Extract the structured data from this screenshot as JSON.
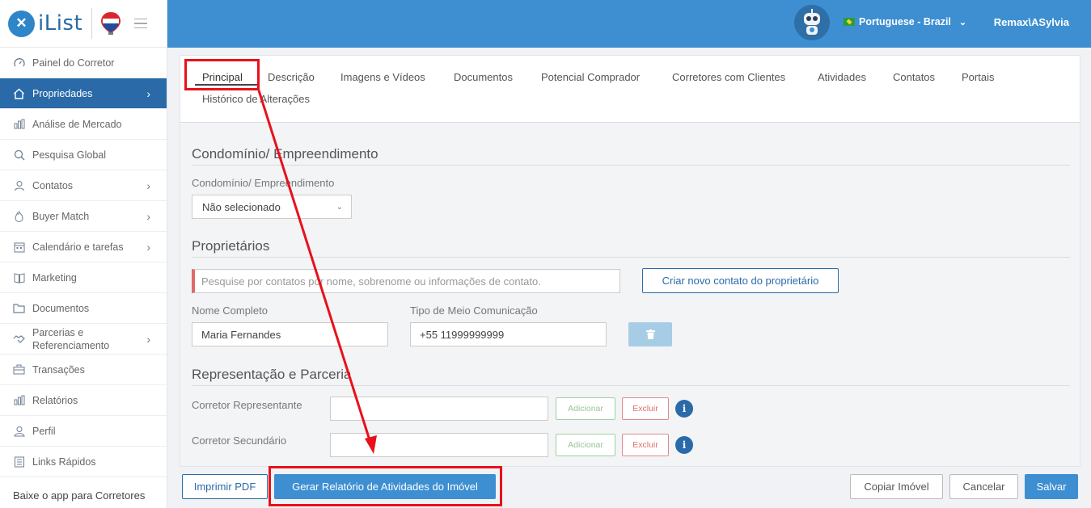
{
  "app": {
    "name": "iList"
  },
  "sidebar": {
    "items": [
      {
        "label": "Painel do Corretor",
        "icon": "dashboard-icon",
        "chevron": false
      },
      {
        "label": "Propriedades",
        "icon": "home-icon",
        "chevron": true,
        "active": true
      },
      {
        "label": "Análise de Mercado",
        "icon": "bar-chart-icon",
        "chevron": false
      },
      {
        "label": "Pesquisa Global",
        "icon": "search-icon",
        "chevron": false
      },
      {
        "label": "Contatos",
        "icon": "contacts-icon",
        "chevron": true
      },
      {
        "label": "Buyer Match",
        "icon": "flame-icon",
        "chevron": true
      },
      {
        "label": "Calendário e tarefas",
        "icon": "calendar-icon",
        "chevron": true
      },
      {
        "label": "Marketing",
        "icon": "book-icon",
        "chevron": false
      },
      {
        "label": "Documentos",
        "icon": "folder-icon",
        "chevron": false
      },
      {
        "label": "Parcerias e Referenciamento",
        "icon": "handshake-icon",
        "chevron": true
      },
      {
        "label": "Transações",
        "icon": "briefcase-icon",
        "chevron": false
      },
      {
        "label": "Relatórios",
        "icon": "bar-chart-icon",
        "chevron": false
      },
      {
        "label": "Perfil",
        "icon": "user-icon",
        "chevron": false
      },
      {
        "label": "Links Rápidos",
        "icon": "links-icon",
        "chevron": false
      }
    ],
    "footer": "Baixe o app para Corretores"
  },
  "header": {
    "language": "Portuguese - Brazil",
    "user": "Remax\\ASylvia"
  },
  "tabs": [
    "Principal",
    "Descrição",
    "Imagens e Vídeos",
    "Documentos",
    "Potencial Comprador",
    "Corretores com Clientes",
    "Atividades",
    "Contatos",
    "Portais",
    "Histórico de Alterações"
  ],
  "condominio": {
    "section_title": "Condomínio/ Empreendimento",
    "field_label": "Condomínio/ Empreendimento",
    "selected": "Não selecionado"
  },
  "proprietarios": {
    "section_title": "Proprietários",
    "search_placeholder": "Pesquise por contatos por nome, sobrenome ou informações de contato.",
    "new_contact_button": "Criar novo contato do proprietário",
    "name_label": "Nome Completo",
    "name_value": "Maria Fernandes",
    "comm_label": "Tipo de Meio Comunicação",
    "comm_value": "+55 11999999999"
  },
  "representacao": {
    "section_title": "Representação e Parceria",
    "rows": [
      {
        "label": "Corretor Representante",
        "add": "Adicionar",
        "remove": "Excluir"
      },
      {
        "label": "Corretor Secundário",
        "add": "Adicionar",
        "remove": "Excluir"
      }
    ]
  },
  "footer_buttons": {
    "print_pdf": "Imprimir PDF",
    "activity_report": "Gerar Relatório de Atividades do Imóvel",
    "copy": "Copiar Imóvel",
    "cancel": "Cancelar",
    "save": "Salvar"
  },
  "colors": {
    "header": "#3d8fd1",
    "sidebar_active": "#2a6aa8",
    "annotation": "#e8111a"
  }
}
